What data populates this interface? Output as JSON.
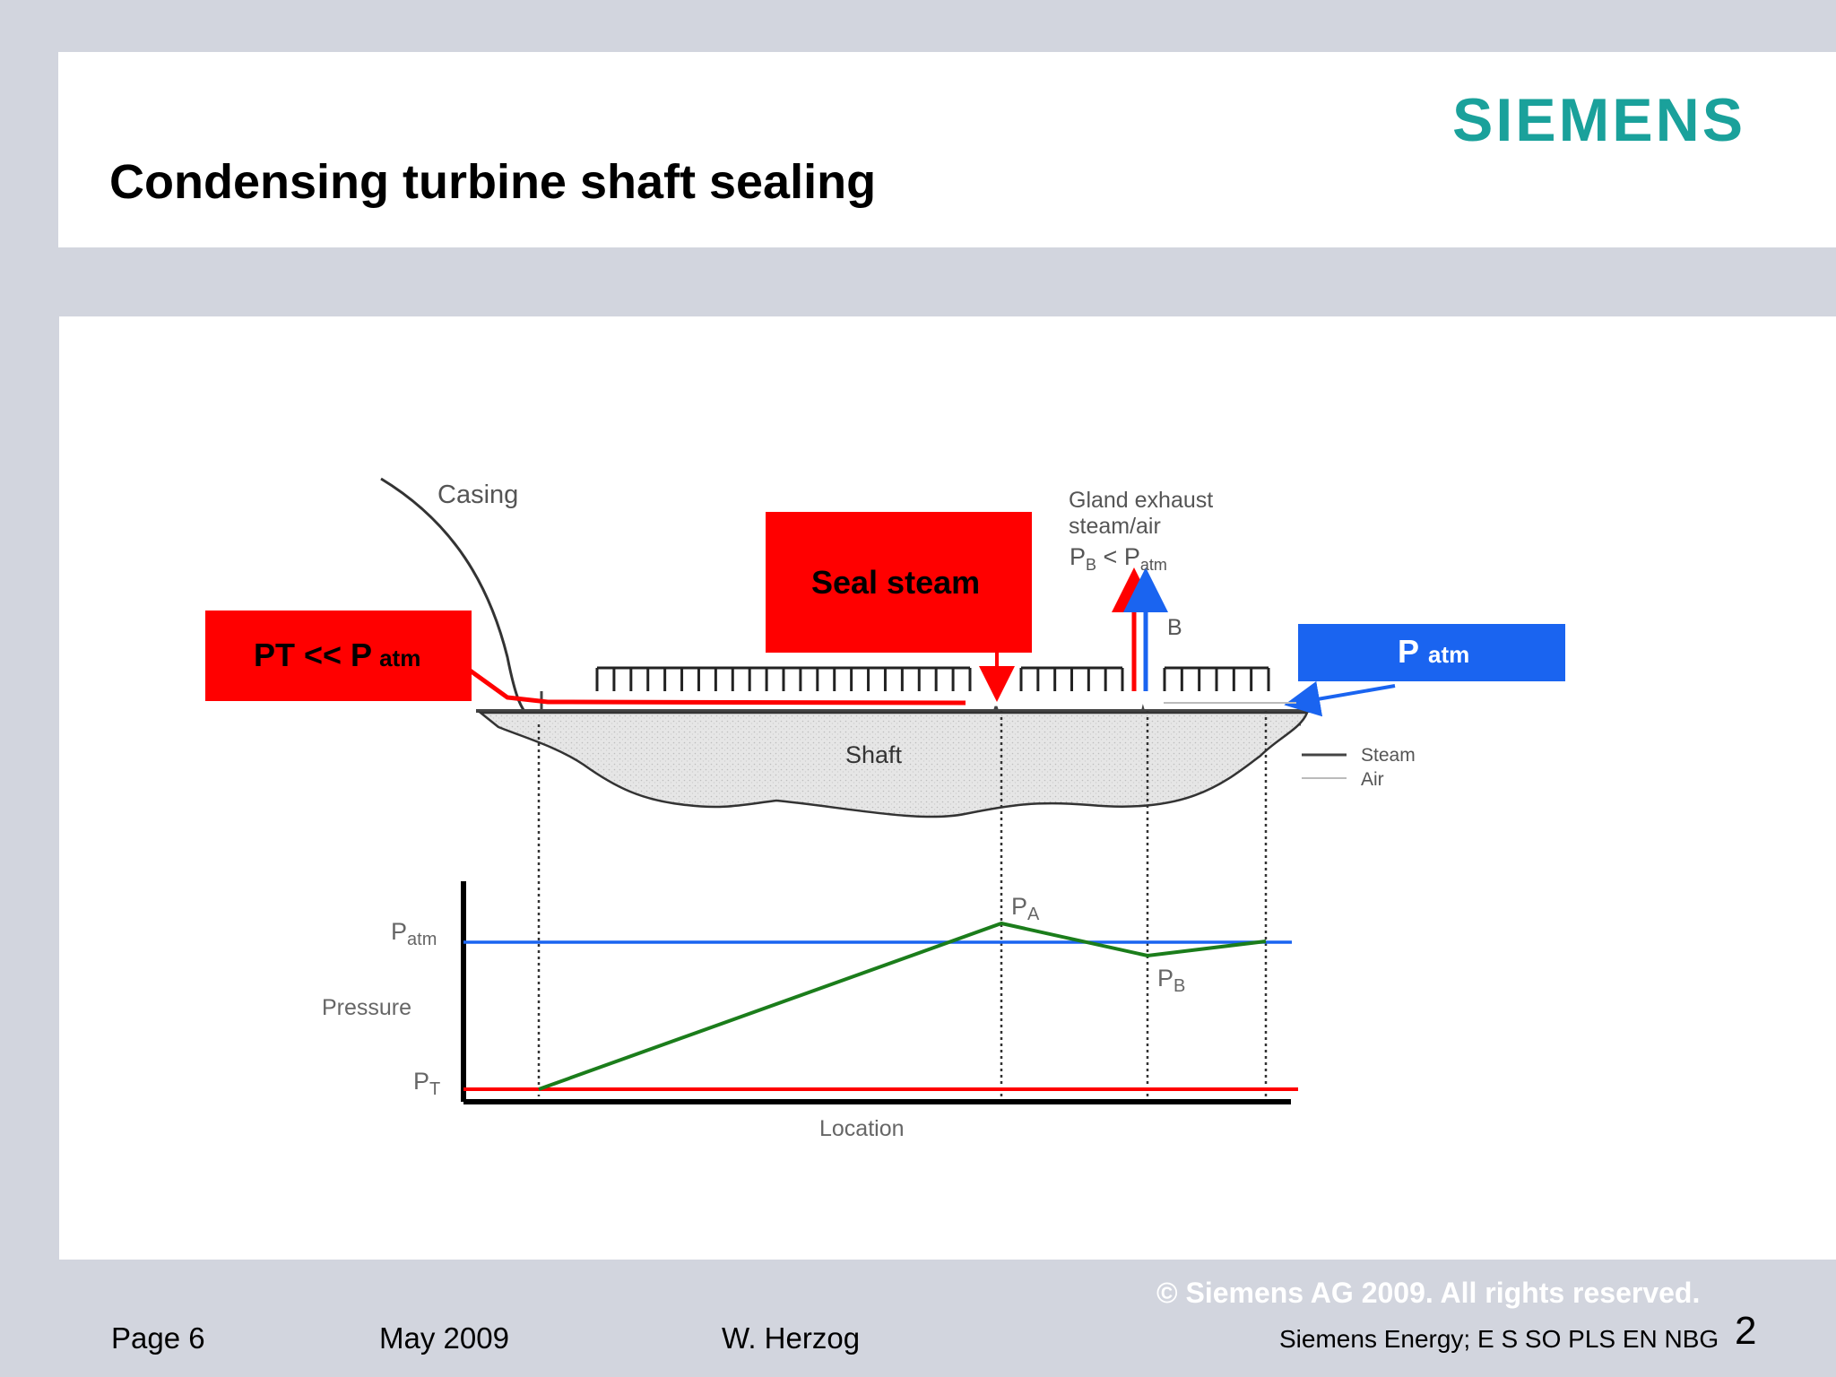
{
  "header": {
    "title": "Condensing turbine shaft sealing",
    "logo_text": "SIEMENS"
  },
  "diagram": {
    "casing_label": "Casing",
    "shaft_label": "Shaft",
    "gland_exhaust_line1": "Gland exhaust",
    "gland_exhaust_line2": "steam/air",
    "pb_lt_patm": {
      "p1": "P",
      "s1": "B",
      "op": " < ",
      "p2": "P",
      "s2": "atm"
    },
    "b_label": "B",
    "legend": {
      "steam": "Steam",
      "air": "Air"
    },
    "callouts": {
      "pt_box": {
        "main": "PT << P",
        "sub": "atm"
      },
      "seal_steam": "Seal steam",
      "patm_box": {
        "main": "P",
        "sub": "atm"
      }
    },
    "graph": {
      "ylabel": "Pressure",
      "xlabel": "Location",
      "patm_label": {
        "p": "P",
        "sub": "atm"
      },
      "pt_label": {
        "p": "P",
        "sub": "T"
      },
      "pa_label": {
        "p": "P",
        "sub": "A"
      },
      "pb_label": {
        "p": "P",
        "sub": "B"
      }
    }
  },
  "colors": {
    "brand": "#1aa19b",
    "red": "#ff0000",
    "blue": "#1a64f0",
    "green": "#1b7d1b",
    "slide_bg": "#d2d5de"
  },
  "footer": {
    "copyright": "©  Siemens AG  2009. All rights reserved.",
    "page": "Page 6",
    "date": "May 2009",
    "author": "W. Herzog",
    "org": "Siemens Energy; E S SO PLS EN NBG",
    "slide_number": "2"
  }
}
